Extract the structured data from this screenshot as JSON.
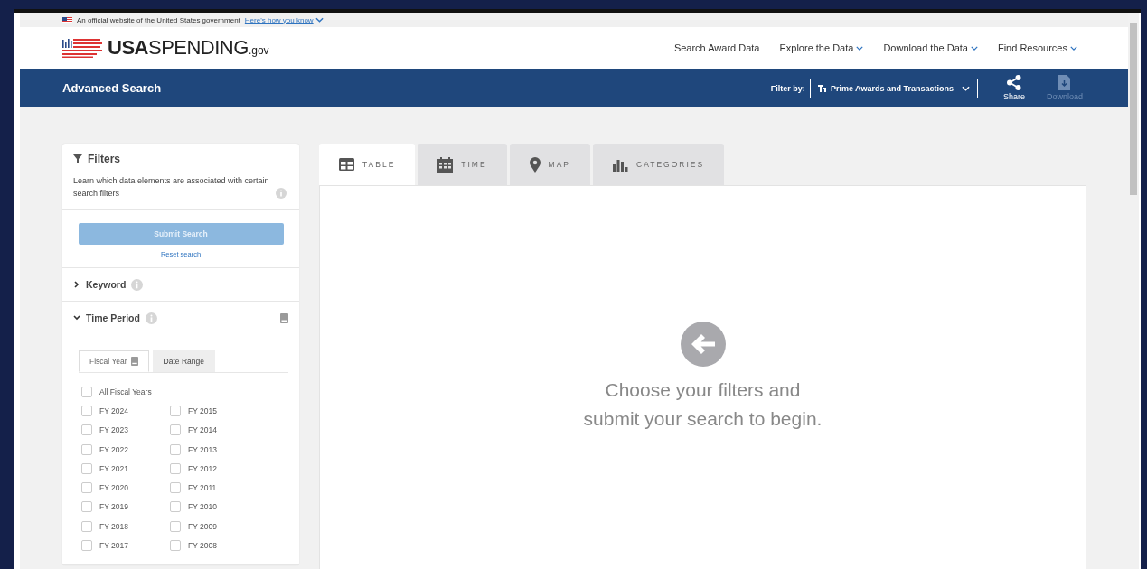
{
  "banner": {
    "text": "An official website of the United States government",
    "link": "Here's how you know"
  },
  "logo": {
    "bold": "USA",
    "light": "SPENDING",
    "suffix": ".gov"
  },
  "nav": [
    {
      "label": "Search Award Data",
      "dropdown": false
    },
    {
      "label": "Explore the Data",
      "dropdown": true
    },
    {
      "label": "Download the Data",
      "dropdown": true
    },
    {
      "label": "Find Resources",
      "dropdown": true
    }
  ],
  "page_bar": {
    "title": "Advanced Search",
    "filter_label": "Filter by:",
    "filter_value": "Prime Awards and Transactions",
    "actions": [
      {
        "kind": "share",
        "label": "Share",
        "disabled": false
      },
      {
        "kind": "download",
        "label": "Download",
        "disabled": true
      }
    ]
  },
  "filters": {
    "title": "Filters",
    "note": "Learn which data elements are associated with certain search filters",
    "submit": {
      "label": "Submit Search",
      "disabled": true
    },
    "reset": "Reset search",
    "sections": [
      {
        "label": "Keyword",
        "expanded": false
      },
      {
        "label": "Time Period",
        "expanded": true
      }
    ],
    "period_tabs": [
      {
        "label": "Fiscal Year",
        "selected": true
      },
      {
        "label": "Date Range",
        "selected": false
      }
    ],
    "all_years": {
      "label": "All Fiscal Years",
      "checked": false
    },
    "years": [
      {
        "label": "FY 2024",
        "checked": false
      },
      {
        "label": "FY 2023",
        "checked": false
      },
      {
        "label": "FY 2022",
        "checked": false
      },
      {
        "label": "FY 2021",
        "checked": false
      },
      {
        "label": "FY 2020",
        "checked": false
      },
      {
        "label": "FY 2019",
        "checked": false
      },
      {
        "label": "FY 2018",
        "checked": false
      },
      {
        "label": "FY 2017",
        "checked": false
      },
      {
        "label": "FY 2015",
        "checked": false
      },
      {
        "label": "FY 2014",
        "checked": false
      },
      {
        "label": "FY 2013",
        "checked": false
      },
      {
        "label": "FY 2012",
        "checked": false
      },
      {
        "label": "FY 2011",
        "checked": false
      },
      {
        "label": "FY 2010",
        "checked": false
      },
      {
        "label": "FY 2009",
        "checked": false
      },
      {
        "label": "FY 2008",
        "checked": false
      }
    ]
  },
  "view_tabs": [
    {
      "kind": "table",
      "label": "TABLE",
      "selected": true
    },
    {
      "kind": "time",
      "label": "TIME",
      "selected": false
    },
    {
      "kind": "map",
      "label": "MAP",
      "selected": false
    },
    {
      "kind": "categories",
      "label": "CATEGORIES",
      "selected": false
    }
  ],
  "empty_state": {
    "lines": [
      "Choose your filters and",
      "submit your search to begin."
    ]
  }
}
